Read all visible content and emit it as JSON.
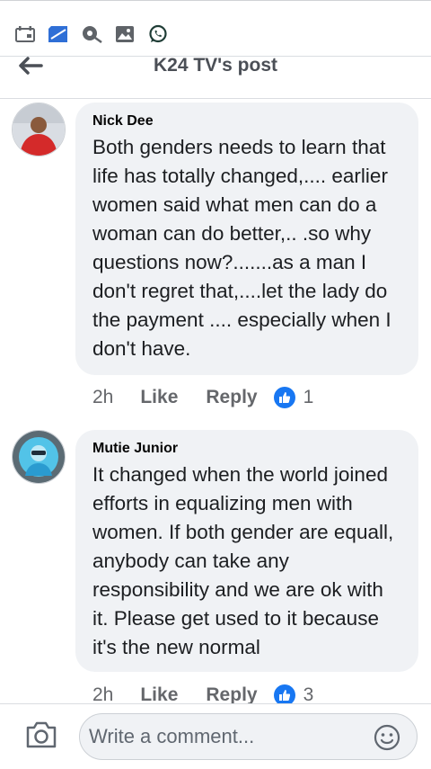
{
  "header": {
    "title": "K24 TV's post"
  },
  "comments": [
    {
      "author": "Nick Dee",
      "text": "Both genders needs to learn that life has totally changed,.... earlier women said what men can do a woman can do better,.. .so why questions now?.......as a man I don't regret that,....let the lady  do the payment .... especially when I don't have.",
      "time": "2h",
      "like_label": "Like",
      "reply_label": "Reply",
      "reactions": "1"
    },
    {
      "author": "Mutie Junior",
      "text": "It changed when the world joined efforts in equalizing men with women. If both gender are equall, anybody can take any responsibility and we are ok with it. Please get used to it because it's the new normal",
      "time": "2h",
      "like_label": "Like",
      "reply_label": "Reply",
      "reactions": "3"
    }
  ],
  "composer": {
    "placeholder": "Write a comment..."
  },
  "colors": {
    "accent": "#1877f2",
    "bubble": "#f0f2f5",
    "meta": "#65676b"
  },
  "status_icons": [
    "calendar-icon",
    "sim-icon",
    "vpn-icon",
    "gallery-icon",
    "whatsapp-icon"
  ]
}
